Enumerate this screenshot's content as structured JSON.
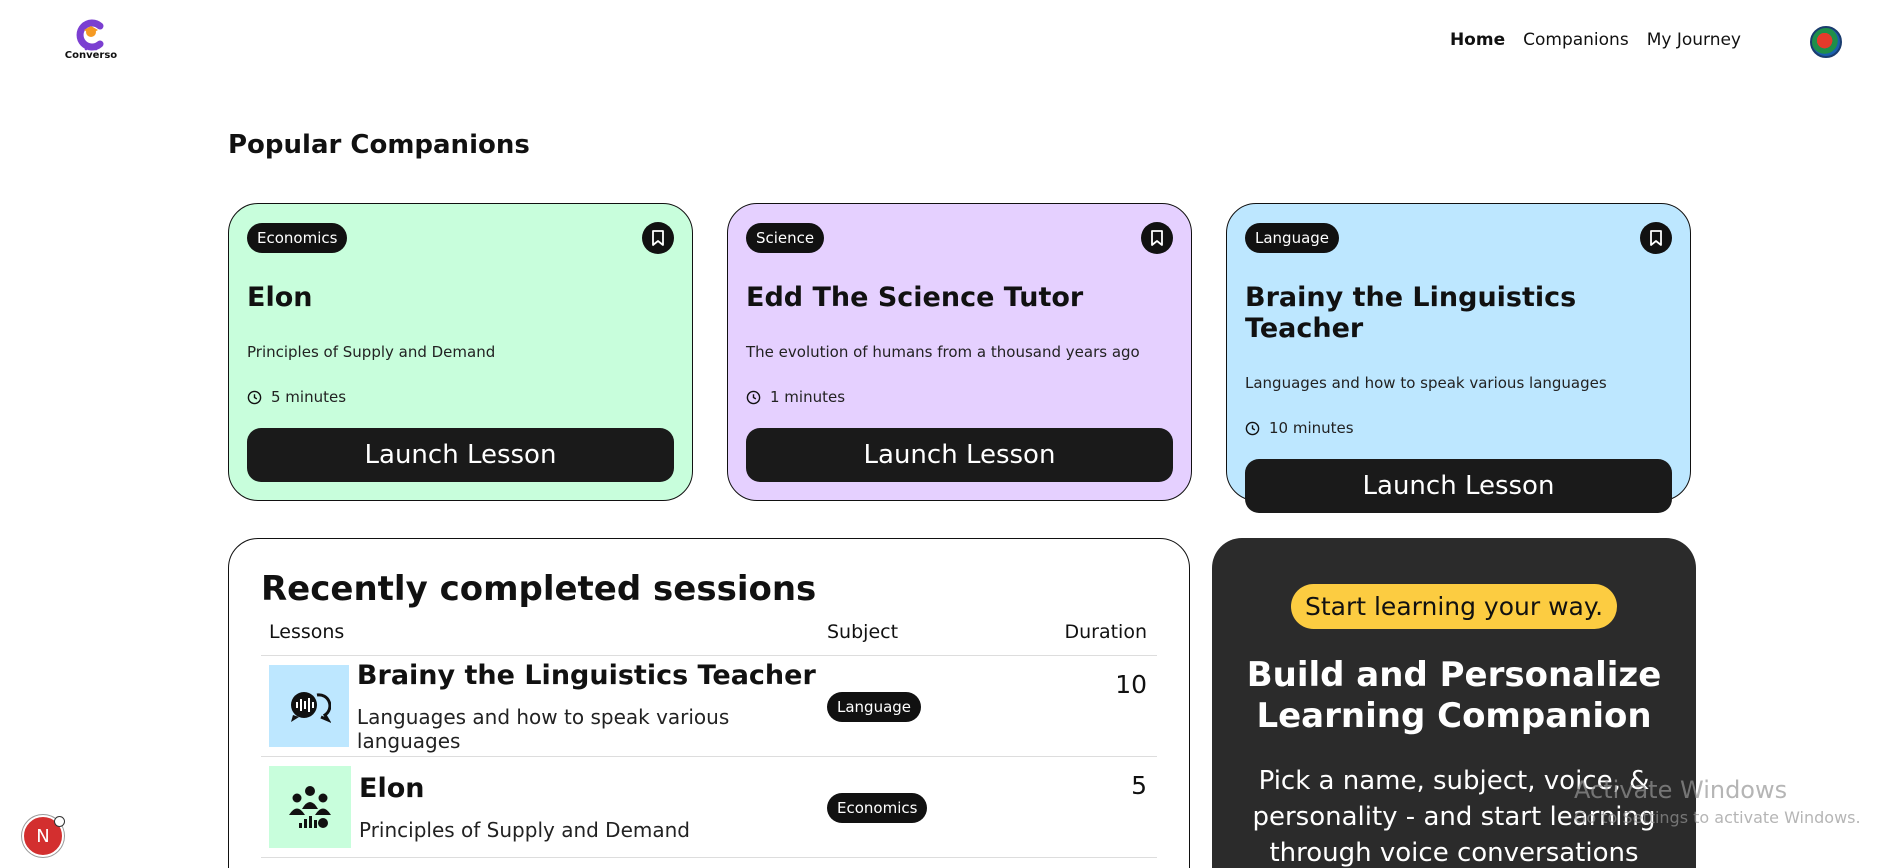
{
  "header": {
    "logo_text": "Converso",
    "nav": [
      "Home",
      "Companions",
      "My Journey"
    ],
    "active_nav": "Home"
  },
  "popular": {
    "title": "Popular Companions",
    "cards": [
      {
        "subject": "Economics",
        "name": "Elon",
        "topic": "Principles of Supply and Demand",
        "duration": "5 minutes",
        "button": "Launch Lesson",
        "color": "#c8fedc"
      },
      {
        "subject": "Science",
        "name": "Edd The Science Tutor",
        "topic": "The evolution of humans from a thousand years ago",
        "duration": "1 minutes",
        "button": "Launch Lesson",
        "color": "#e5d0ff"
      },
      {
        "subject": "Language",
        "name": "Brainy the Linguistics Teacher",
        "topic": "Languages and how to speak various languages",
        "duration": "10 minutes",
        "button": "Launch Lesson",
        "color": "#bde7ff"
      }
    ]
  },
  "sessions": {
    "title": "Recently completed sessions",
    "columns": [
      "Lessons",
      "Subject",
      "Duration"
    ],
    "rows": [
      {
        "name": "Brainy the Linguistics Teacher",
        "topic": "Languages and how to speak various languages",
        "subject": "Language",
        "duration": "10",
        "icon": "language-icon",
        "color": "#bde7ff"
      },
      {
        "name": "Elon",
        "topic": "Principles of Supply and Demand",
        "subject": "Economics",
        "duration": "5",
        "icon": "economics-icon",
        "color": "#c8fedc"
      }
    ]
  },
  "cta": {
    "pill": "Start learning your way.",
    "title": "Build and Personalize Learning Companion",
    "description": "Pick a name, subject, voice, & personality - and start learning through voice conversations"
  },
  "fab_label": "N",
  "watermark": {
    "line1": "Activate Windows",
    "line2": "Go to Settings to activate Windows."
  }
}
